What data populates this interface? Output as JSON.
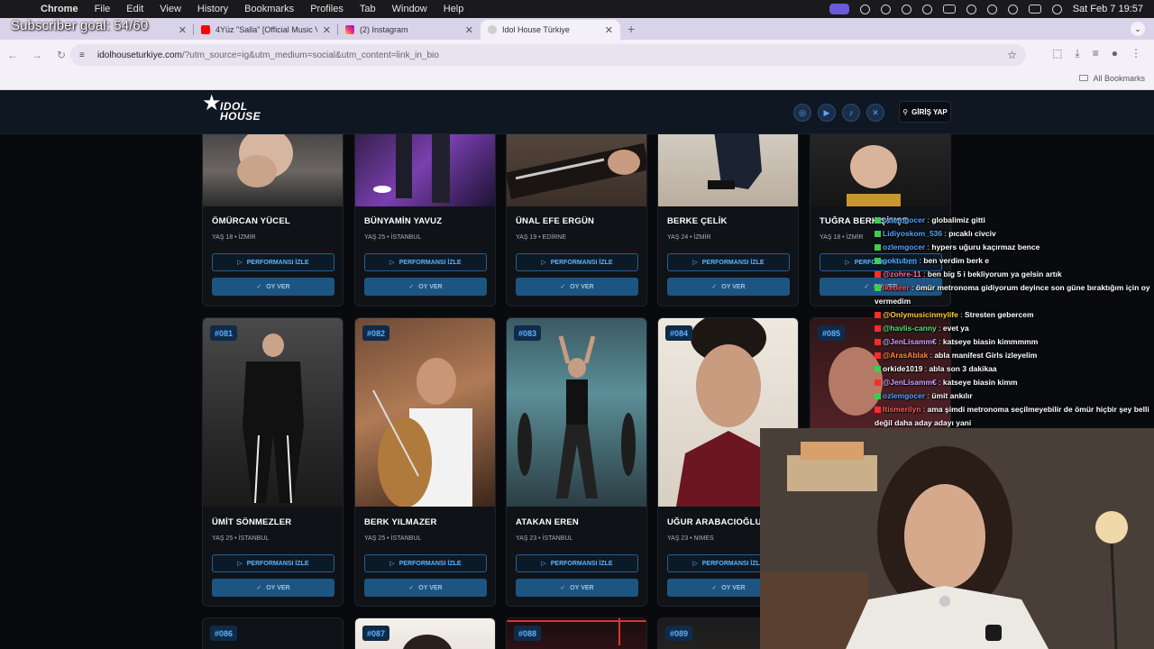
{
  "macos": {
    "app": "Chrome",
    "menus": [
      "File",
      "Edit",
      "View",
      "History",
      "Bookmarks",
      "Profiles",
      "Tab",
      "Window",
      "Help"
    ],
    "clock": "Sat Feb 7  19:57"
  },
  "overlay_title": "Subscriber goal: 54/60",
  "tabs": [
    {
      "title": "",
      "active": false
    },
    {
      "title": "4Yüz \"Salla\" [Official Music V",
      "active": false
    },
    {
      "title": "(2) Instagram",
      "active": false
    },
    {
      "title": "Idol House Türkiye",
      "active": true
    }
  ],
  "address": {
    "host": "idolhouseturkiye.com",
    "path": "/?utm_source=ig&utm_medium=social&utm_content=link_in_bio"
  },
  "bookmarks_bar": {
    "all_bookmarks": "All Bookmarks"
  },
  "site": {
    "logo_line1": "IDOL",
    "logo_line2": "HOUSE",
    "login": "GİRİŞ YAP",
    "watch_label": "PERFORMANSI İZLE",
    "vote_label": "OY VER"
  },
  "row1": [
    {
      "name": "ÖMÜRCAN YÜCEL",
      "meta": "YAŞ 18  •  İZMİR"
    },
    {
      "name": "BÜNYAMİN YAVUZ",
      "meta": "YAŞ 25  •  İSTANBUL"
    },
    {
      "name": "ÜNAL EFE ERGÜN",
      "meta": "YAŞ 19  •  EDİRNE"
    },
    {
      "name": "BERKE ÇELİK",
      "meta": "YAŞ 24  •  İZMİR"
    },
    {
      "name": "TUĞRA BERK ŞİMŞE",
      "meta": "YAŞ 18  •  İZMİR"
    }
  ],
  "row2": [
    {
      "num": "#081",
      "name": "ÜMİT SÖNMEZLER",
      "meta": "YAŞ 25  •  İSTANBUL"
    },
    {
      "num": "#082",
      "name": "BERK YILMAZER",
      "meta": "YAŞ 25  •  İSTANBUL"
    },
    {
      "num": "#083",
      "name": "ATAKAN EREN",
      "meta": "YAŞ 23  •  İSTANBUL"
    },
    {
      "num": "#084",
      "name": "UĞUR ARABACIOĞLU",
      "meta": "YAŞ 23  •  NIMES"
    },
    {
      "num": "#085",
      "name": "",
      "meta": ""
    }
  ],
  "row3": [
    {
      "num": "#086"
    },
    {
      "num": "#087"
    },
    {
      "num": "#088"
    },
    {
      "num": "#089"
    }
  ],
  "chat": [
    {
      "user": "ozlemgocer",
      "msg": "globalimiz gitti",
      "color": "#4fa3ff"
    },
    {
      "user": "Lidiyoskom_536",
      "msg": "pıcaklı civciv",
      "color": "#4fa3ff"
    },
    {
      "user": "ozlemgocer",
      "msg": "hypers uğuru kaçırmaz bence",
      "color": "#4fa3ff"
    },
    {
      "user": "goktuben",
      "msg": "ben verdim berk e",
      "color": "#4fa3ff"
    },
    {
      "user": "@zohre-11",
      "msg": "ben big 5 i bekliyorum ya gelsin artık",
      "color": "#ff6fa8"
    },
    {
      "user": "lkedeer",
      "msg": "ömür metronoma gidiyorum deyince son güne bıraktığım için oy vermedim",
      "color": "#ff4d4d"
    },
    {
      "user": "@Onlymusicinmylife",
      "msg": "Stresten gebercem",
      "color": "#ffd23a"
    },
    {
      "user": "@havlis-canny",
      "msg": "evet ya",
      "color": "#58e07a"
    },
    {
      "user": "@JenLisamm€",
      "msg": "katseye biasin kimmmmm",
      "color": "#cfa2ff"
    },
    {
      "user": "@ArasAblak",
      "msg": "abla manifest Girls izleyelim",
      "color": "#ff8a3d"
    },
    {
      "user": "orkide1019",
      "msg": "abla son 3 dakikaa",
      "color": "#ffffff"
    },
    {
      "user": "@JenLisamm€",
      "msg": "katseye biasin kimm",
      "color": "#cfa2ff"
    },
    {
      "user": "ozlemgocer",
      "msg": "ümit ankılır",
      "color": "#4fa3ff"
    },
    {
      "user": "Itismerilyn",
      "msg": "ama şimdi metronoma seçilmeyebilir de ömür hiçbir şey belli değil daha aday adayı yani",
      "color": "#ff5b5b"
    }
  ]
}
